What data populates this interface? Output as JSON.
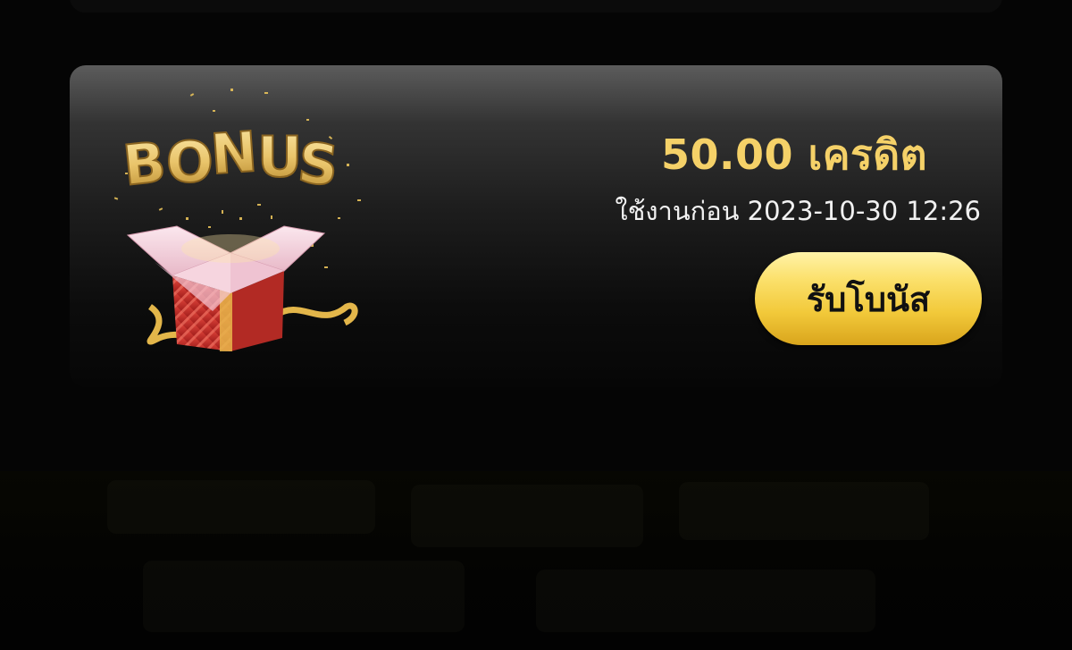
{
  "bonus_card": {
    "art_text": "BONUS",
    "amount": "50.00 เครดิต",
    "expiry": "ใช้งานก่อน 2023-10-30 12:26",
    "claim_label": "รับโบนัส"
  },
  "colors": {
    "accent_gold": "#f5d168",
    "button_gold": "#f2c93a",
    "card_top": "#5c5c5c",
    "background": "#000000"
  },
  "icons": {
    "bonus_art": "bonus-gift-box-icon"
  }
}
